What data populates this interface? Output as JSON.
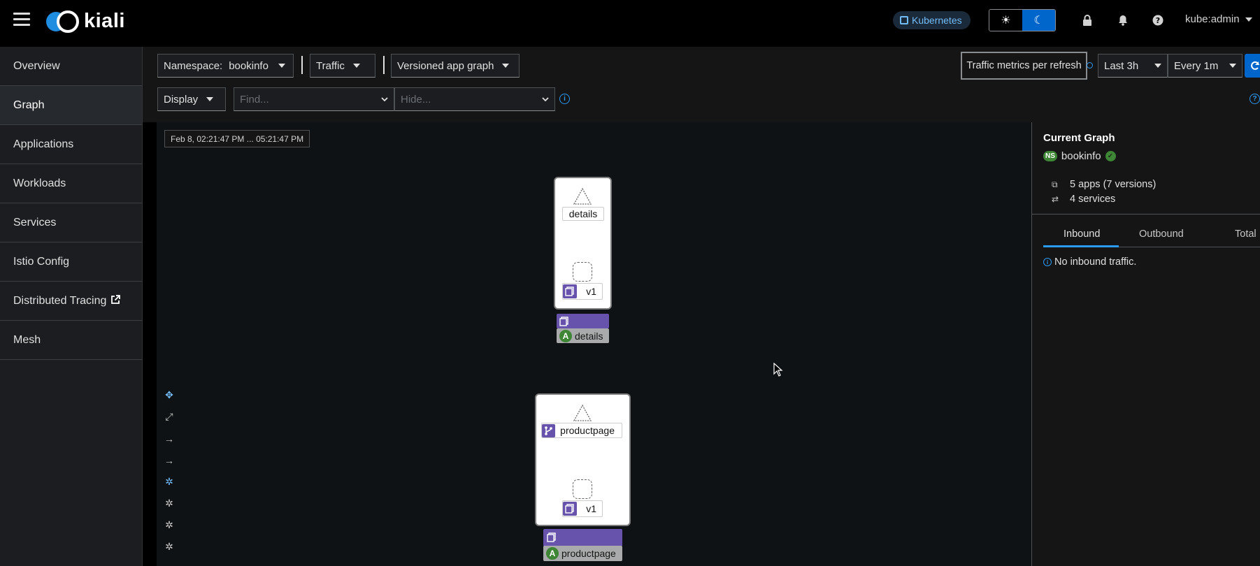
{
  "header": {
    "logo_text": "kiali",
    "cluster_badge": "Kubernetes",
    "user": "kube:admin"
  },
  "sidebar": {
    "items": [
      {
        "label": "Overview"
      },
      {
        "label": "Graph"
      },
      {
        "label": "Applications"
      },
      {
        "label": "Workloads"
      },
      {
        "label": "Services"
      },
      {
        "label": "Istio Config"
      },
      {
        "label": "Distributed Tracing"
      },
      {
        "label": "Mesh"
      }
    ]
  },
  "toolbar": {
    "namespace_label": "Namespace:",
    "namespace_value": "bookinfo",
    "traffic": "Traffic",
    "graph_type": "Versioned app graph",
    "metrics_per_refresh": "Traffic metrics per refresh",
    "duration": "Last 3h",
    "refresh_interval": "Every 1m",
    "display": "Display",
    "find_placeholder": "Find...",
    "hide_placeholder": "Hide..."
  },
  "graph": {
    "time_range": "Feb 8, 02:21:47 PM ... 05:21:47 PM",
    "nodes": {
      "details_service": "details",
      "details_version": "v1",
      "details_app": "details",
      "productpage_service": "productpage",
      "productpage_version": "v1",
      "productpage_app": "productpage",
      "app_badge_letter": "A"
    }
  },
  "panel": {
    "title": "Current Graph",
    "ns_badge": "NS",
    "namespace": "bookinfo",
    "apps": "5 apps (7 versions)",
    "services": "4 services",
    "tabs": [
      "Inbound",
      "Outbound",
      "Total"
    ],
    "message": "No inbound traffic."
  },
  "colors": {
    "accent": "#0066cc",
    "workload_purple": "#6753ac",
    "healthy_green": "#3e8635"
  }
}
